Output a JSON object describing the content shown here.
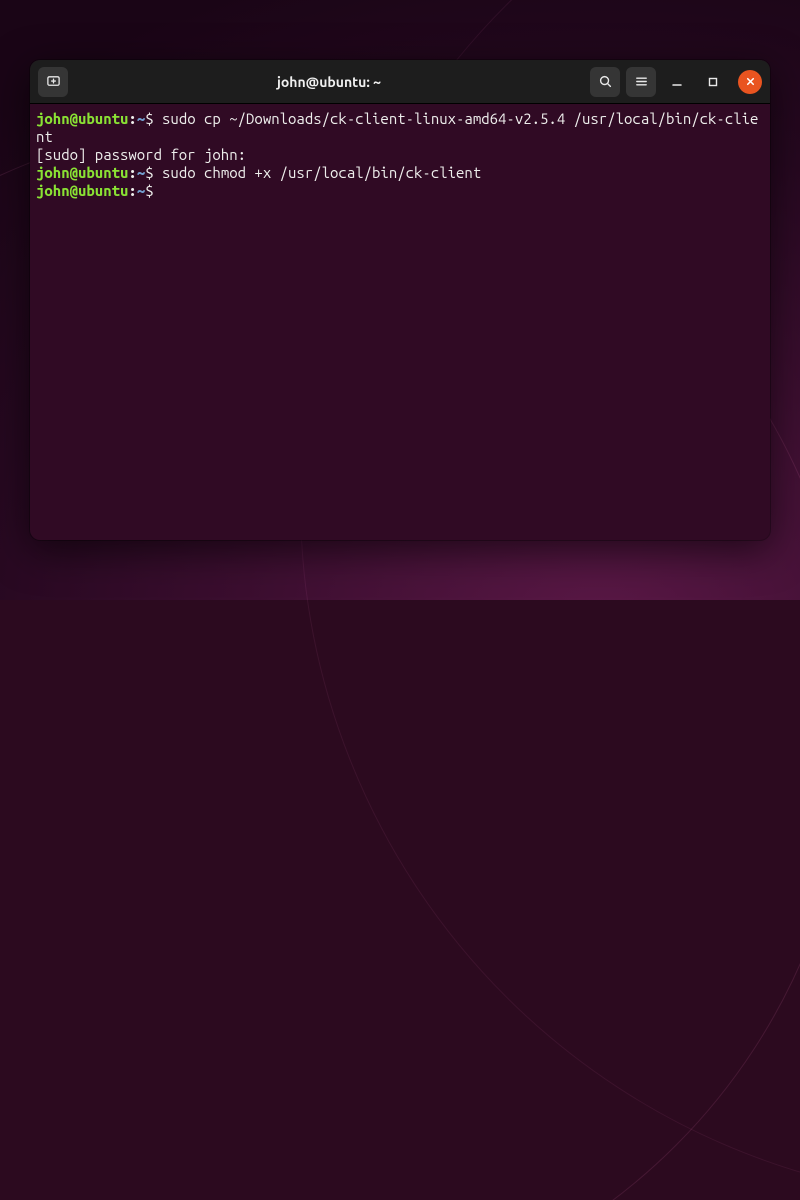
{
  "window": {
    "title": "john@ubuntu: ~"
  },
  "prompt": {
    "userhost": "john@ubuntu",
    "colon": ":",
    "path": "~",
    "symbol": "$"
  },
  "lines": {
    "l1_cmd": " sudo cp ~/Downloads/ck-client-linux-amd64-v2.5.4 /usr/local/bin/ck-client",
    "l2_output": "[sudo] password for john:",
    "l3_cmd": " sudo chmod +x /usr/local/bin/ck-client",
    "l4_cmd": " "
  }
}
